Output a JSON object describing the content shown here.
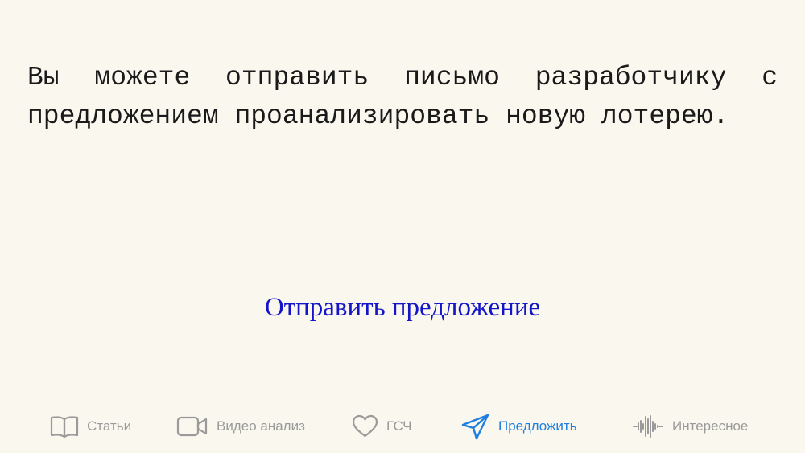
{
  "message": {
    "text": "Вы можете отправить письмо разработчику с предложением проанализировать новую лотерею."
  },
  "action": {
    "label": "Отправить предложение",
    "color": "#1414c8"
  },
  "tabbar": {
    "active_color": "#1f7fe0",
    "inactive_color": "#9a9a9a",
    "items": [
      {
        "label": "Статьи",
        "icon": "book-icon",
        "active": false
      },
      {
        "label": "Видео анализ",
        "icon": "video-camera-icon",
        "active": false
      },
      {
        "label": "ГСЧ",
        "icon": "heart-icon",
        "active": false
      },
      {
        "label": "Предложить",
        "icon": "paper-plane-icon",
        "active": true
      },
      {
        "label": "Интересное",
        "icon": "waveform-icon",
        "active": false
      }
    ]
  }
}
